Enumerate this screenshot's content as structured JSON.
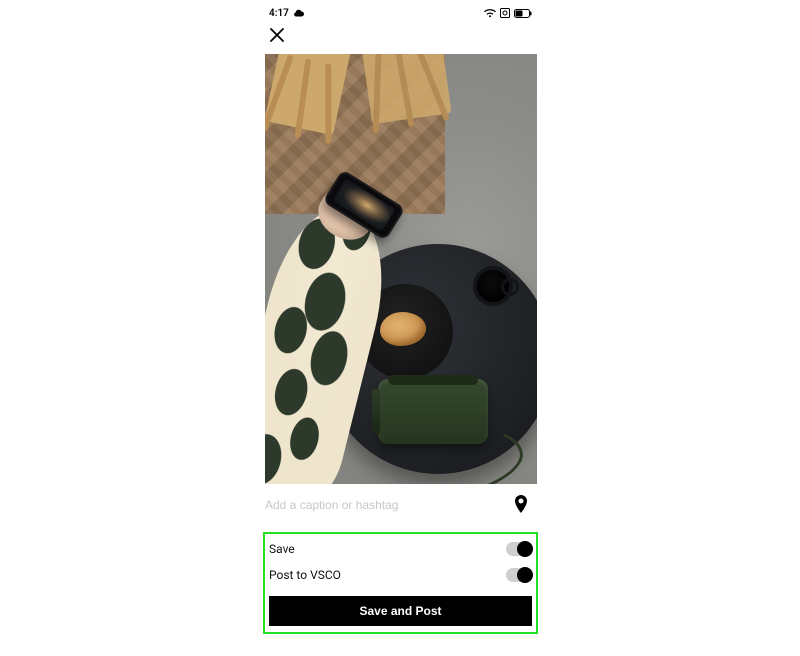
{
  "status": {
    "time": "4:17"
  },
  "caption": {
    "placeholder": "Add a caption or hashtag",
    "value": ""
  },
  "options": {
    "save_label": "Save",
    "post_label": "Post to VSCO",
    "save_on": true,
    "post_on": true
  },
  "actions": {
    "primary_label": "Save and Post"
  }
}
